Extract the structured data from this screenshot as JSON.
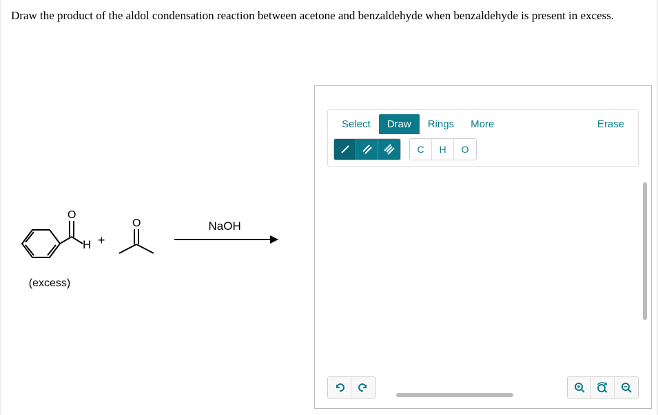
{
  "question": "Draw the product of the aldol condensation reaction between acetone and benzaldehyde when benzaldehyde is present in excess.",
  "reaction": {
    "reactant1_annotation": "(excess)",
    "plus": "+",
    "reagent": "NaOH",
    "benzaldehyde_h": "H"
  },
  "toolbar": {
    "tabs": {
      "select": "Select",
      "draw": "Draw",
      "rings": "Rings",
      "more": "More"
    },
    "erase": "Erase",
    "atoms": {
      "c": "C",
      "h": "H",
      "o": "O"
    }
  },
  "icons": {
    "undo": "↶",
    "redo": "↷",
    "zoom_in": "⊕",
    "zoom_reset": "⟲",
    "zoom_out": "⊖"
  }
}
